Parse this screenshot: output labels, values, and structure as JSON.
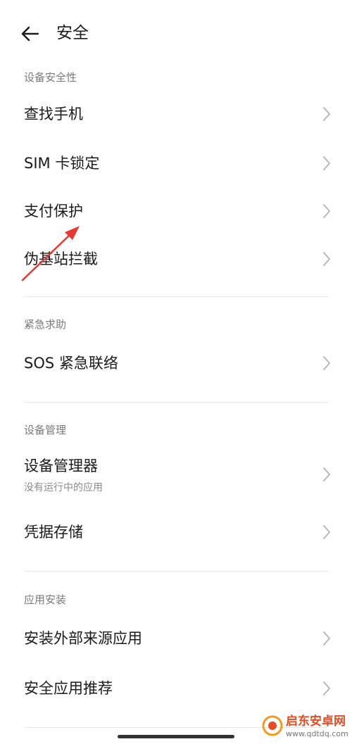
{
  "header": {
    "title": "安全"
  },
  "sections": [
    {
      "header": "设备安全性",
      "items": [
        {
          "label": "查找手机"
        },
        {
          "label": "SIM 卡锁定"
        },
        {
          "label": "支付保护"
        },
        {
          "label": "伪基站拦截"
        }
      ]
    },
    {
      "header": "紧急求助",
      "items": [
        {
          "label": "SOS 紧急联络"
        }
      ]
    },
    {
      "header": "设备管理",
      "items": [
        {
          "label": "设备管理器",
          "subtitle": "没有运行中的应用"
        },
        {
          "label": "凭据存储"
        }
      ]
    },
    {
      "header": "应用安装",
      "items": [
        {
          "label": "安装外部来源应用"
        },
        {
          "label": "安全应用推荐"
        }
      ]
    }
  ],
  "watermark": {
    "title": "启东安卓网",
    "url": "www.qdtdq.com"
  },
  "colors": {
    "text_primary": "#1a1a1a",
    "text_secondary": "#7a7a7a",
    "chevron": "#b3b3b3",
    "annotation_arrow": "#e8382f"
  }
}
